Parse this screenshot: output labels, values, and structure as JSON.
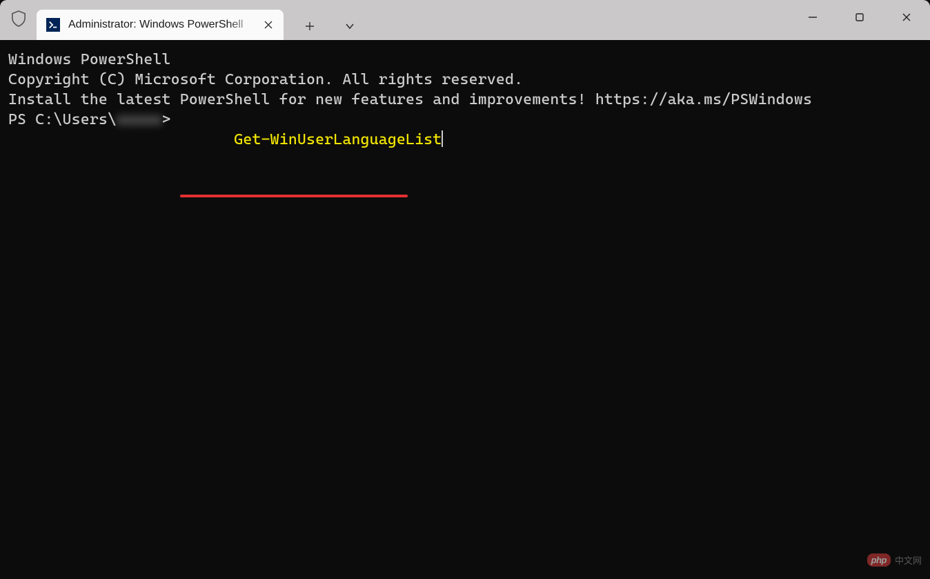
{
  "titlebar": {
    "tab": {
      "title": "Administrator: Windows PowerShell"
    }
  },
  "terminal": {
    "line1": "Windows PowerShell",
    "line2": "Copyright (C) Microsoft Corporation. All rights reserved.",
    "line3": "",
    "line4": "Install the latest PowerShell for new features and improvements! https://aka.ms/PSWindows",
    "line5": "",
    "prompt": {
      "prefix": "PS C:\\Users\\",
      "user_blurred": "xxxxx",
      "suffix": "> ",
      "command": "Get-WinUserLanguageList"
    }
  },
  "watermark": {
    "logo": "php",
    "text": "中文网"
  }
}
